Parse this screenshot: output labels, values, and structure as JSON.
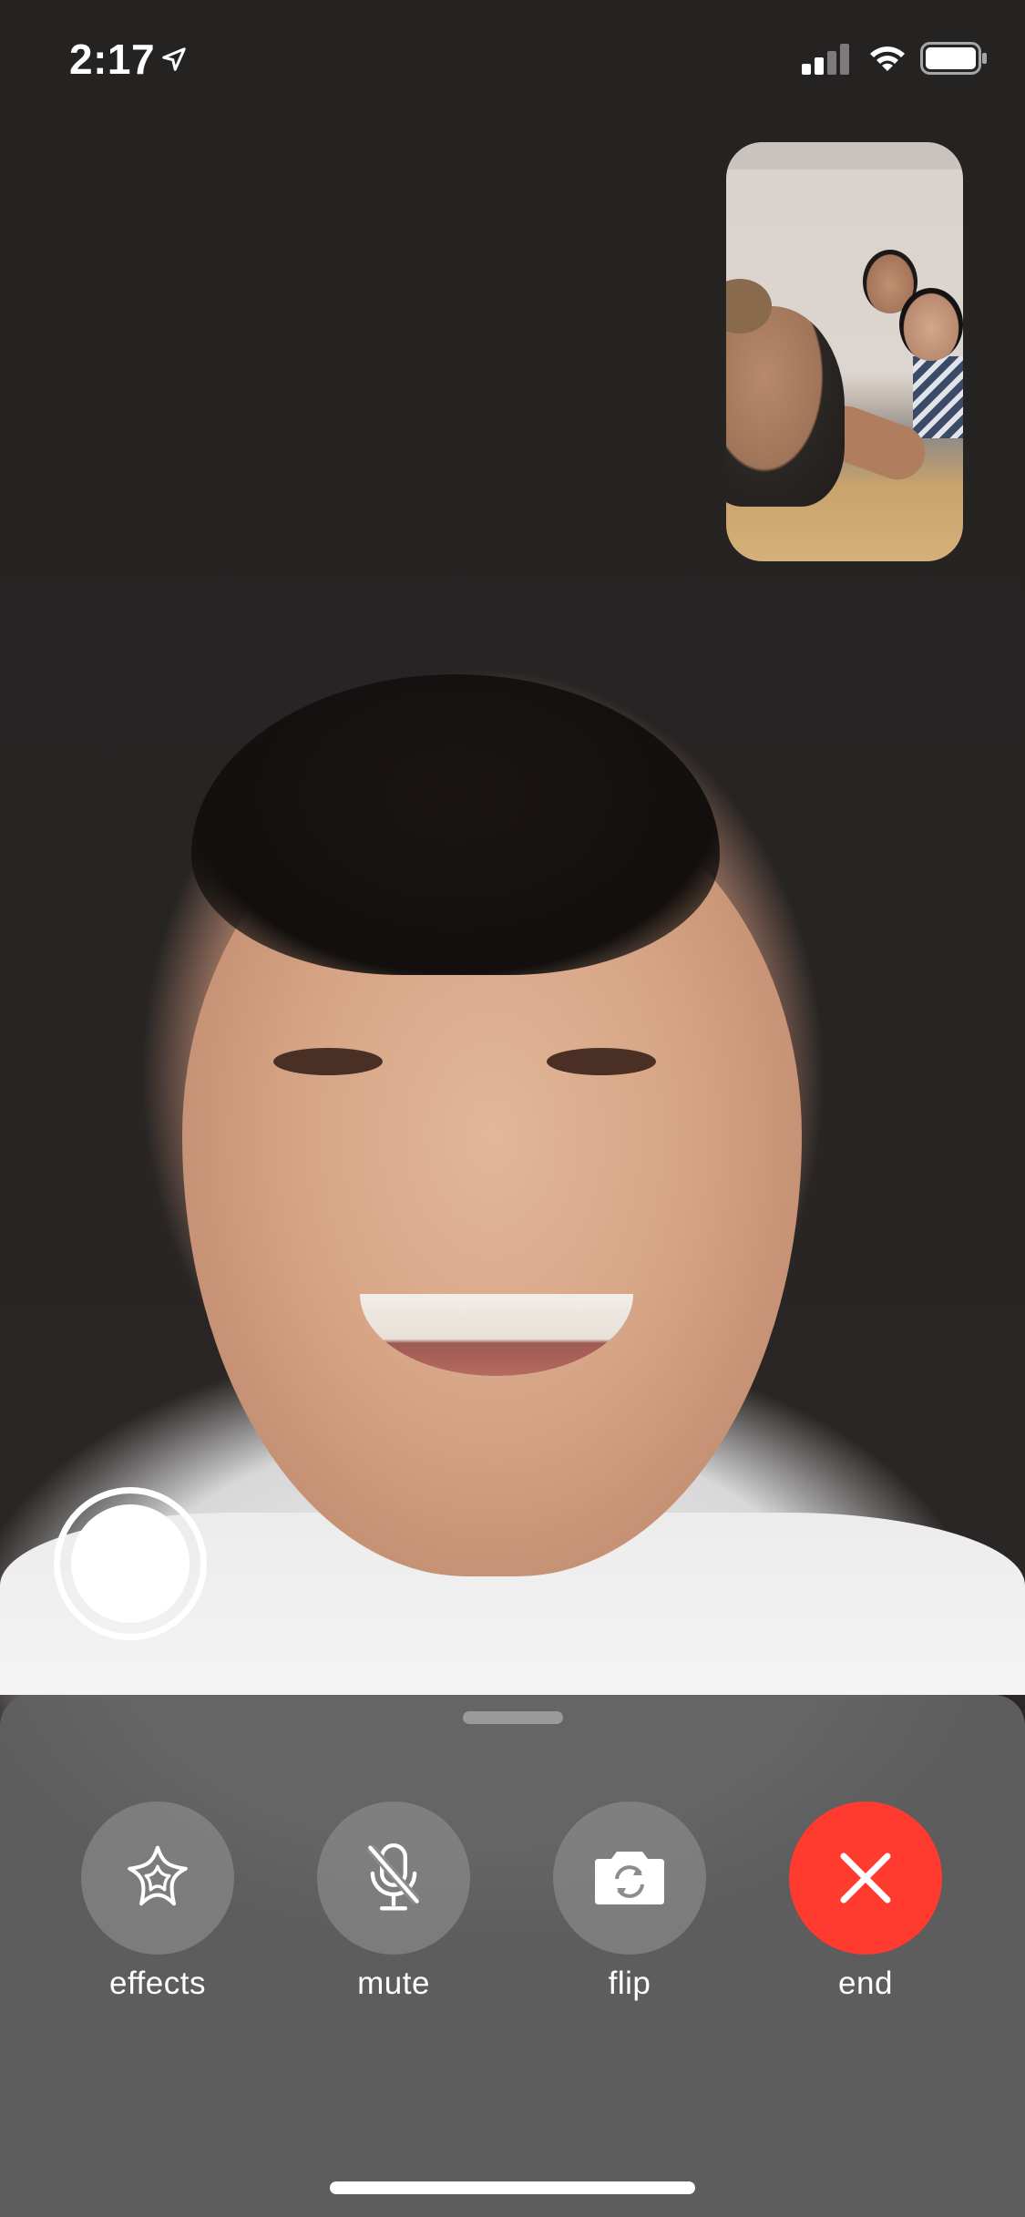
{
  "status_bar": {
    "time": "2:17",
    "location_icon": "location-arrow-icon",
    "signal_icon": "cellular-signal-icon",
    "wifi_icon": "wifi-icon",
    "battery_icon": "battery-icon"
  },
  "call": {
    "remote_video": "remote-participant-video",
    "self_preview": "self-preview-video"
  },
  "controls": {
    "effects_label": "effects",
    "mute_label": "mute",
    "flip_label": "flip",
    "end_label": "end"
  },
  "colors": {
    "end_button": "#ff3b30",
    "sheet_background": "#606060",
    "control_circle": "#969696"
  }
}
